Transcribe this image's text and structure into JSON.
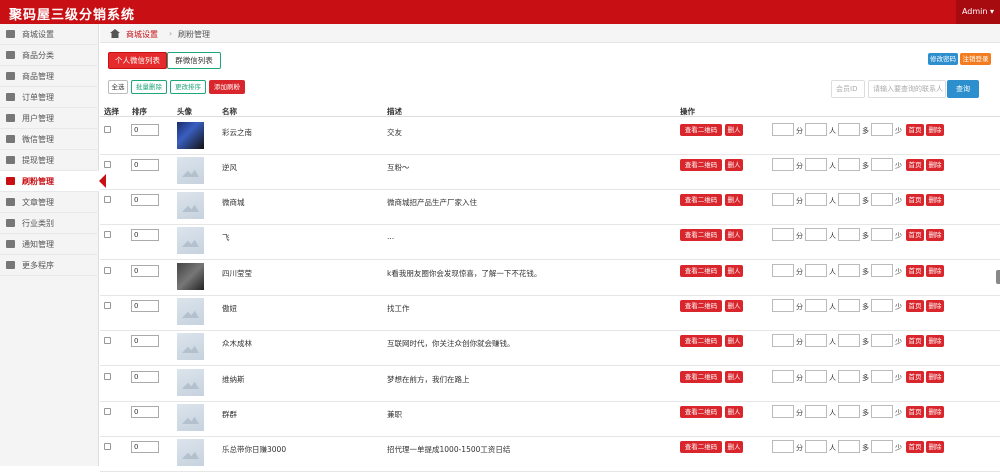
{
  "header": {
    "title": "聚码屋三级分销系统",
    "user": "Admin"
  },
  "sidebar": {
    "items": [
      {
        "label": "商城设置",
        "icon": "home-icon",
        "active": false
      },
      {
        "label": "商品分类",
        "icon": "list-icon",
        "active": false
      },
      {
        "label": "商品管理",
        "icon": "gift-icon",
        "active": false
      },
      {
        "label": "订单管理",
        "icon": "calendar-icon",
        "active": false
      },
      {
        "label": "用户管理",
        "icon": "users-icon",
        "active": false
      },
      {
        "label": "微信管理",
        "icon": "edit-icon",
        "active": false
      },
      {
        "label": "提现管理",
        "icon": "calendar-icon",
        "active": false
      },
      {
        "label": "刷粉管理",
        "icon": "users-icon",
        "active": true
      },
      {
        "label": "文章管理",
        "icon": "list-icon",
        "active": false
      },
      {
        "label": "行业类别",
        "icon": "list-icon",
        "active": false
      },
      {
        "label": "通知管理",
        "icon": "list-icon",
        "active": false
      },
      {
        "label": "更多程序",
        "icon": "users-icon",
        "active": false
      }
    ]
  },
  "breadcrumb": {
    "parent": "商城设置",
    "current": "刷粉管理"
  },
  "tabs": {
    "personal": "个人微信列表",
    "group": "群微信列表"
  },
  "header_buttons": {
    "change_password": "修改密码",
    "logout": "注销登录"
  },
  "actions": {
    "select_all": "全选",
    "batch_delete": "批量删除",
    "change_sort": "更改排序",
    "add_fans": "添加刷粉"
  },
  "search": {
    "member_id_placeholder": "会员ID",
    "keyword_placeholder": "请输入要查询的联系人",
    "button": "查询"
  },
  "table": {
    "headers": {
      "select": "选择",
      "sort": "排序",
      "avatar": "头像",
      "name": "名称",
      "desc": "描述",
      "ops": "操作"
    },
    "op_labels": {
      "qr": "查看二维码",
      "delete_person": "删人",
      "minute": "分",
      "person": "人",
      "more": "多",
      "few": "少",
      "confirm": "首页",
      "delete": "删除"
    },
    "rows": [
      {
        "sort": "0",
        "name": "彩云之南",
        "desc": "交友",
        "avatar": "img1"
      },
      {
        "sort": "0",
        "name": "逆风",
        "desc": "互粉～",
        "avatar": "ph"
      },
      {
        "sort": "0",
        "name": "微商城",
        "desc": "微商城招产品生产厂家入住",
        "avatar": "ph"
      },
      {
        "sort": "0",
        "name": "飞",
        "desc": "...",
        "avatar": "ph"
      },
      {
        "sort": "0",
        "name": "四川莹莹",
        "desc": "k看我朋友圈你会发现惊喜，了解一下不花钱。",
        "avatar": "img2"
      },
      {
        "sort": "0",
        "name": "傲妞",
        "desc": "找工作",
        "avatar": "ph"
      },
      {
        "sort": "0",
        "name": "众木成林",
        "desc": "互联网时代，你关注众创你就会赚钱。",
        "avatar": "ph"
      },
      {
        "sort": "0",
        "name": "维纳斯",
        "desc": "梦想在前方，我们在路上",
        "avatar": "ph"
      },
      {
        "sort": "0",
        "name": "群群",
        "desc": "兼职",
        "avatar": "ph"
      },
      {
        "sort": "0",
        "name": "乐总带你日赚3000",
        "desc": "招代理一单提成1000-1500工资日结",
        "avatar": "ph"
      }
    ]
  },
  "colors": {
    "brand": "#c80f14",
    "danger": "#d9262c",
    "primary": "#2d8fce",
    "warning": "#f47c20",
    "success": "#1fa67a"
  }
}
